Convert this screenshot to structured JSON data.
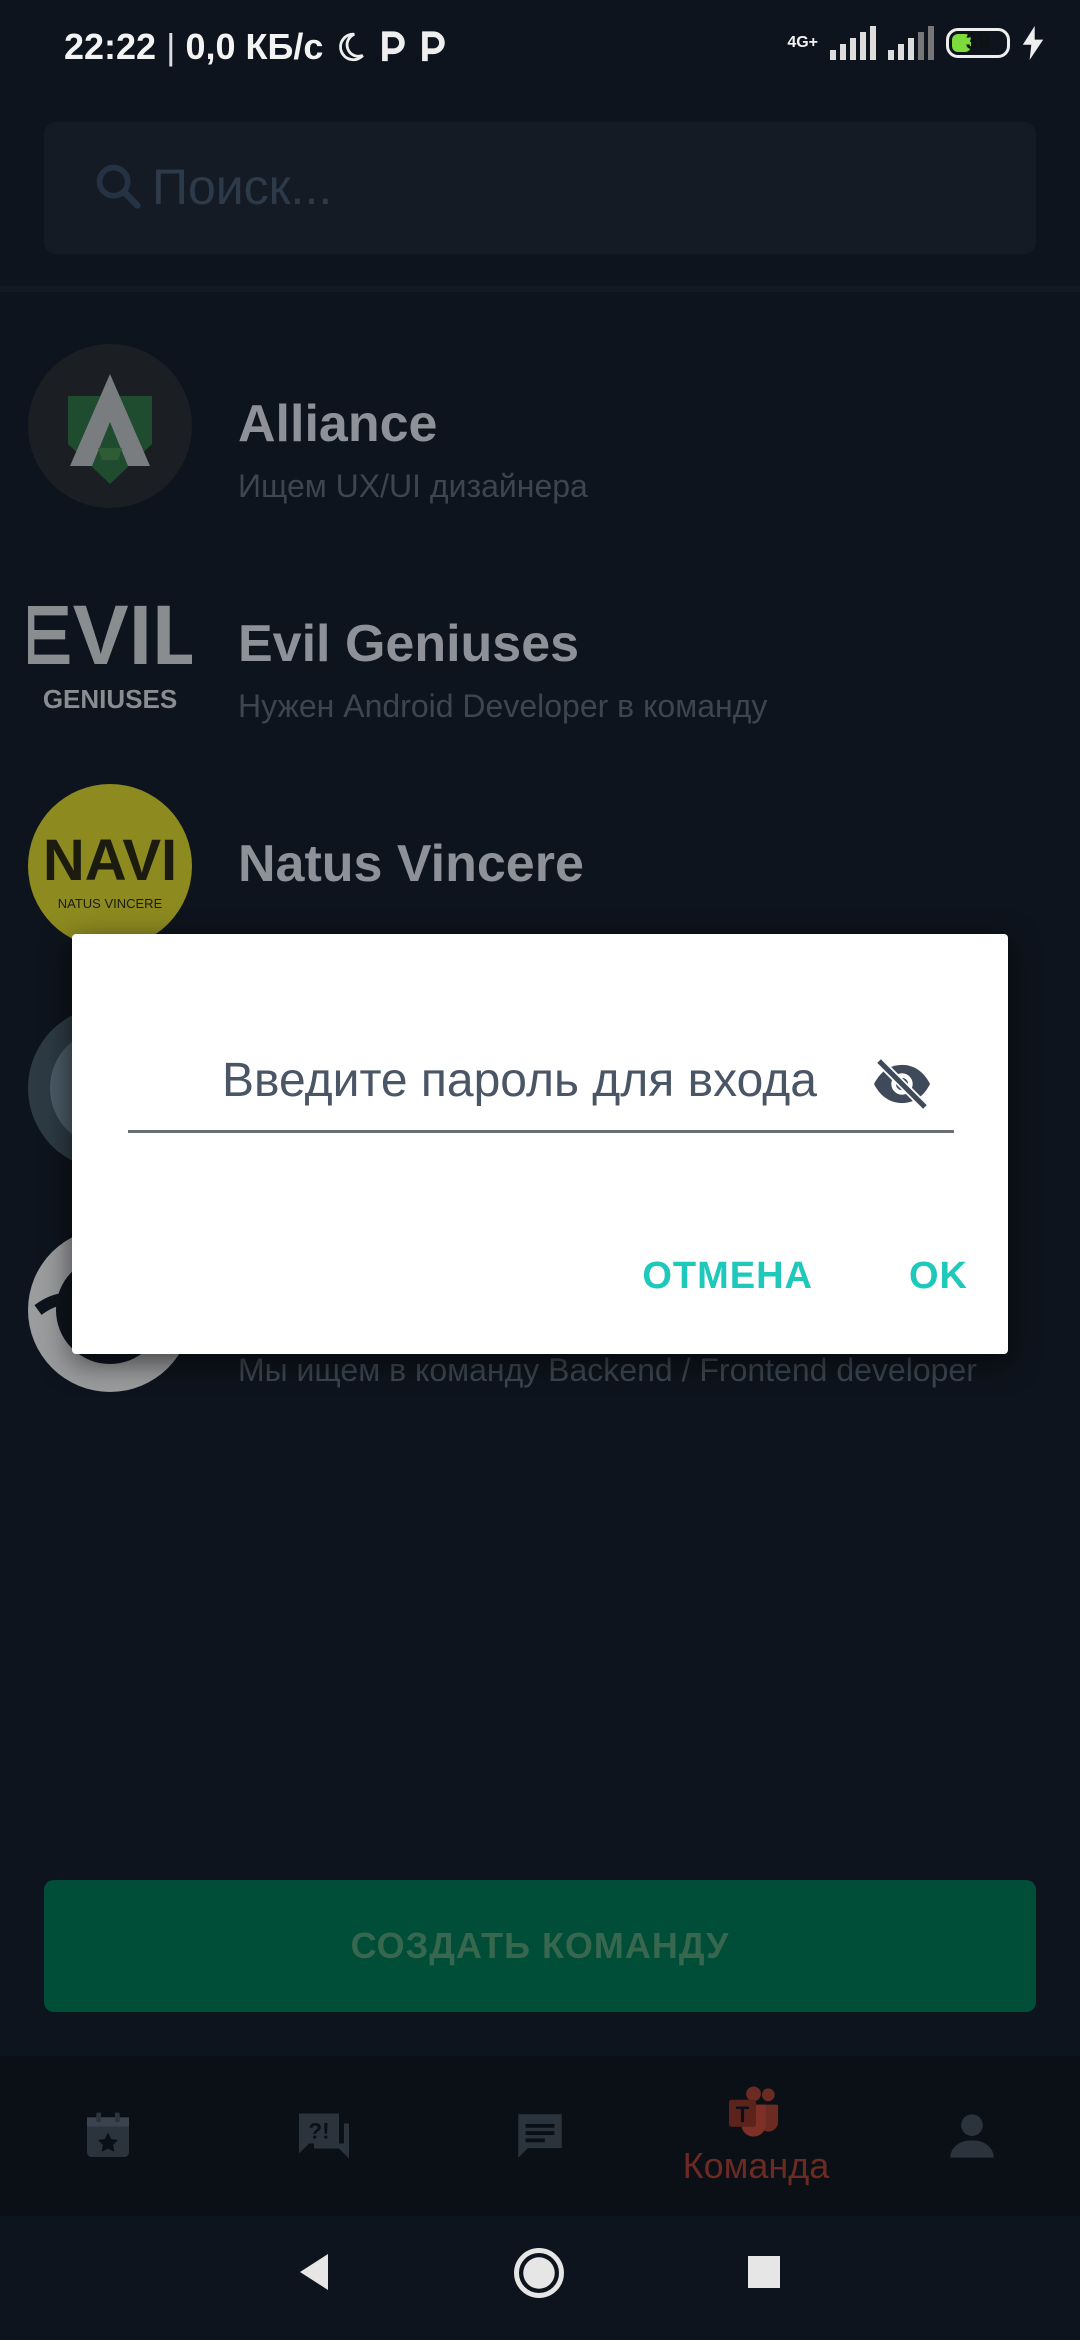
{
  "status_bar": {
    "time": "22:22",
    "separator": "|",
    "speed": "0,0 КБ/с",
    "network_type": "4G+",
    "battery_level": "39"
  },
  "search": {
    "placeholder": "Поиск..."
  },
  "teams": [
    {
      "name": "Alliance",
      "description": "Ищем UX/UI дизайнера"
    },
    {
      "name": "Evil Geniuses",
      "description": "Нужен Android Developer в команду"
    },
    {
      "name": "Natus Vincere",
      "description": ""
    },
    {
      "name": "",
      "description": ""
    },
    {
      "name": "",
      "description": "Мы ищем в команду Backend / Frontend developer"
    }
  ],
  "logos": {
    "evil_top": "EVIL",
    "evil_bottom": "GENIUSES",
    "navi_big": "NAVI",
    "navi_small": "NATUS VINCERE"
  },
  "create_button": {
    "label": "СОЗДАТЬ КОМАНДУ"
  },
  "bottom_nav": {
    "items": [
      {
        "icon": "calendar-star-icon",
        "label": ""
      },
      {
        "icon": "question-chat-icon",
        "label": ""
      },
      {
        "icon": "chat-icon",
        "label": ""
      },
      {
        "icon": "teams-icon",
        "label": "Команда"
      },
      {
        "icon": "person-icon",
        "label": ""
      }
    ],
    "active_index": 3
  },
  "dialog": {
    "password_placeholder": "Введите пароль для входа",
    "cancel_label": "ОТМЕНА",
    "ok_label": "OK"
  },
  "colors": {
    "accent": "#1ec8bb",
    "create_button_bg": "#004d38",
    "nav_active": "#6b2a22",
    "background": "#0e141d"
  }
}
